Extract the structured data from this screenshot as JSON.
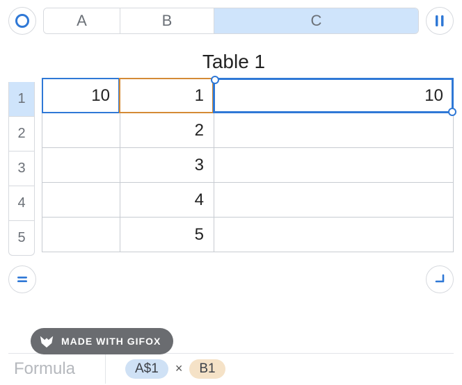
{
  "columns": {
    "A": "A",
    "B": "B",
    "C": "C"
  },
  "rows": {
    "r1": "1",
    "r2": "2",
    "r3": "3",
    "r4": "4",
    "r5": "5"
  },
  "title": "Table 1",
  "cells": {
    "A1": "10",
    "B1": "1",
    "B2": "2",
    "B3": "3",
    "B4": "4",
    "B5": "5",
    "C1": "10"
  },
  "selected_column": "C",
  "selected_row": "1",
  "formula": {
    "label": "Formula",
    "token_a": "A$1",
    "operator": "×",
    "token_b": "B1"
  },
  "gifox": "MADE WITH GIFOX",
  "colors": {
    "accent": "#2f78d6",
    "ref_a_fill": "#d5def0",
    "ref_b_fill": "#f5e4d0",
    "ref_b_border": "#d48a35"
  }
}
